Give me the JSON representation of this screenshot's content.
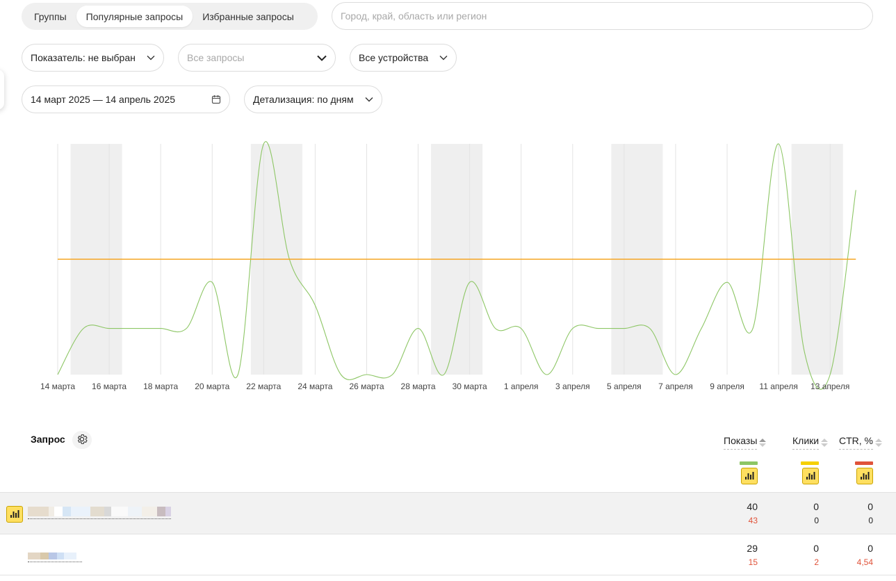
{
  "tabs": [
    {
      "label": "Группы",
      "active": false
    },
    {
      "label": "Популярные запросы",
      "active": true
    },
    {
      "label": "Избранные запросы",
      "active": false
    }
  ],
  "region_input": {
    "placeholder": "Город, край, область или регион",
    "value": ""
  },
  "filters": {
    "indicator": "Показатель: не выбран",
    "queries_placeholder": "Все запросы",
    "devices": "Все устройства",
    "date_range": "14 март 2025 — 14 апрель 2025",
    "detail": "Детализация: по дням"
  },
  "chart_data": {
    "type": "line",
    "x_tick_labels": [
      "14 марта",
      "16 марта",
      "18 марта",
      "20 марта",
      "22 марта",
      "24 марта",
      "26 марта",
      "28 марта",
      "30 марта",
      "1 апреля",
      "3 апреля",
      "5 апреля",
      "7 апреля",
      "9 апреля",
      "11 апреля",
      "13 апреля"
    ],
    "x": [
      "2025-03-14",
      "2025-03-15",
      "2025-03-16",
      "2025-03-17",
      "2025-03-18",
      "2025-03-19",
      "2025-03-20",
      "2025-03-21",
      "2025-03-22",
      "2025-03-23",
      "2025-03-24",
      "2025-03-25",
      "2025-03-26",
      "2025-03-27",
      "2025-03-28",
      "2025-03-29",
      "2025-03-30",
      "2025-03-31",
      "2025-04-01",
      "2025-04-02",
      "2025-04-03",
      "2025-04-04",
      "2025-04-05",
      "2025-04-06",
      "2025-04-07",
      "2025-04-08",
      "2025-04-09",
      "2025-04-10",
      "2025-04-11",
      "2025-04-12",
      "2025-04-13",
      "2025-04-14"
    ],
    "series": [
      {
        "color": "#8dc665",
        "values": [
          0,
          2,
          2,
          2,
          2,
          2,
          4,
          0,
          10,
          5,
          3,
          0,
          0,
          0,
          2,
          0,
          4,
          2,
          2,
          0,
          2,
          2,
          2,
          2,
          0,
          2,
          4,
          2,
          10,
          1,
          0,
          8
        ]
      },
      {
        "color": "#f5a623",
        "values": [
          5,
          5,
          5,
          5,
          5,
          5,
          5,
          5,
          5,
          5,
          5,
          5,
          5,
          5,
          5,
          5,
          5,
          5,
          5,
          5,
          5,
          5,
          5,
          5,
          5,
          5,
          5,
          5,
          5,
          5,
          5,
          5
        ]
      }
    ],
    "weekend_bands": [
      [
        "2025-03-15",
        "2025-03-16"
      ],
      [
        "2025-03-22",
        "2025-03-23"
      ],
      [
        "2025-03-29",
        "2025-03-30"
      ],
      [
        "2025-04-05",
        "2025-04-06"
      ],
      [
        "2025-04-12",
        "2025-04-13"
      ]
    ],
    "ylim": [
      0,
      10
    ],
    "grid": true,
    "legend": "none"
  },
  "table": {
    "query_header": "Запрос",
    "columns": [
      {
        "label": "Показы",
        "color": "#8dc665"
      },
      {
        "label": "Клики",
        "color": "#f5d000"
      },
      {
        "label": "CTR, %",
        "color": "#e0533a"
      }
    ],
    "rows": [
      {
        "values": [
          "40",
          "0",
          "0"
        ],
        "prev": [
          "43",
          "0",
          "0"
        ]
      },
      {
        "values": [
          "29",
          "0",
          "0"
        ],
        "prev": [
          "15",
          "2",
          "4,54"
        ]
      }
    ]
  }
}
